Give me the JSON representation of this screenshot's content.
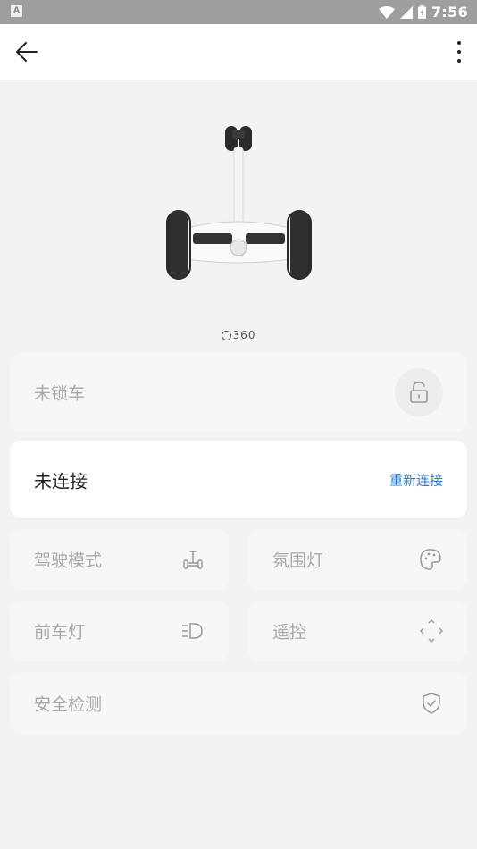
{
  "status_bar": {
    "app_badge": "A",
    "time": "7:56"
  },
  "device": {
    "brand": "360"
  },
  "lock_card": {
    "label": "未锁车",
    "icon": "unlock-icon"
  },
  "connection_card": {
    "label": "未连接",
    "action": "重新连接",
    "action_color": "#1a7fe6"
  },
  "tiles": [
    {
      "label": "驾驶模式",
      "icon": "scooter-mode-icon"
    },
    {
      "label": "氛围灯",
      "icon": "palette-icon"
    },
    {
      "label": "前车灯",
      "icon": "headlight-icon"
    },
    {
      "label": "遥控",
      "icon": "remote-control-icon"
    },
    {
      "label": "安全检测",
      "icon": "shield-check-icon"
    }
  ]
}
